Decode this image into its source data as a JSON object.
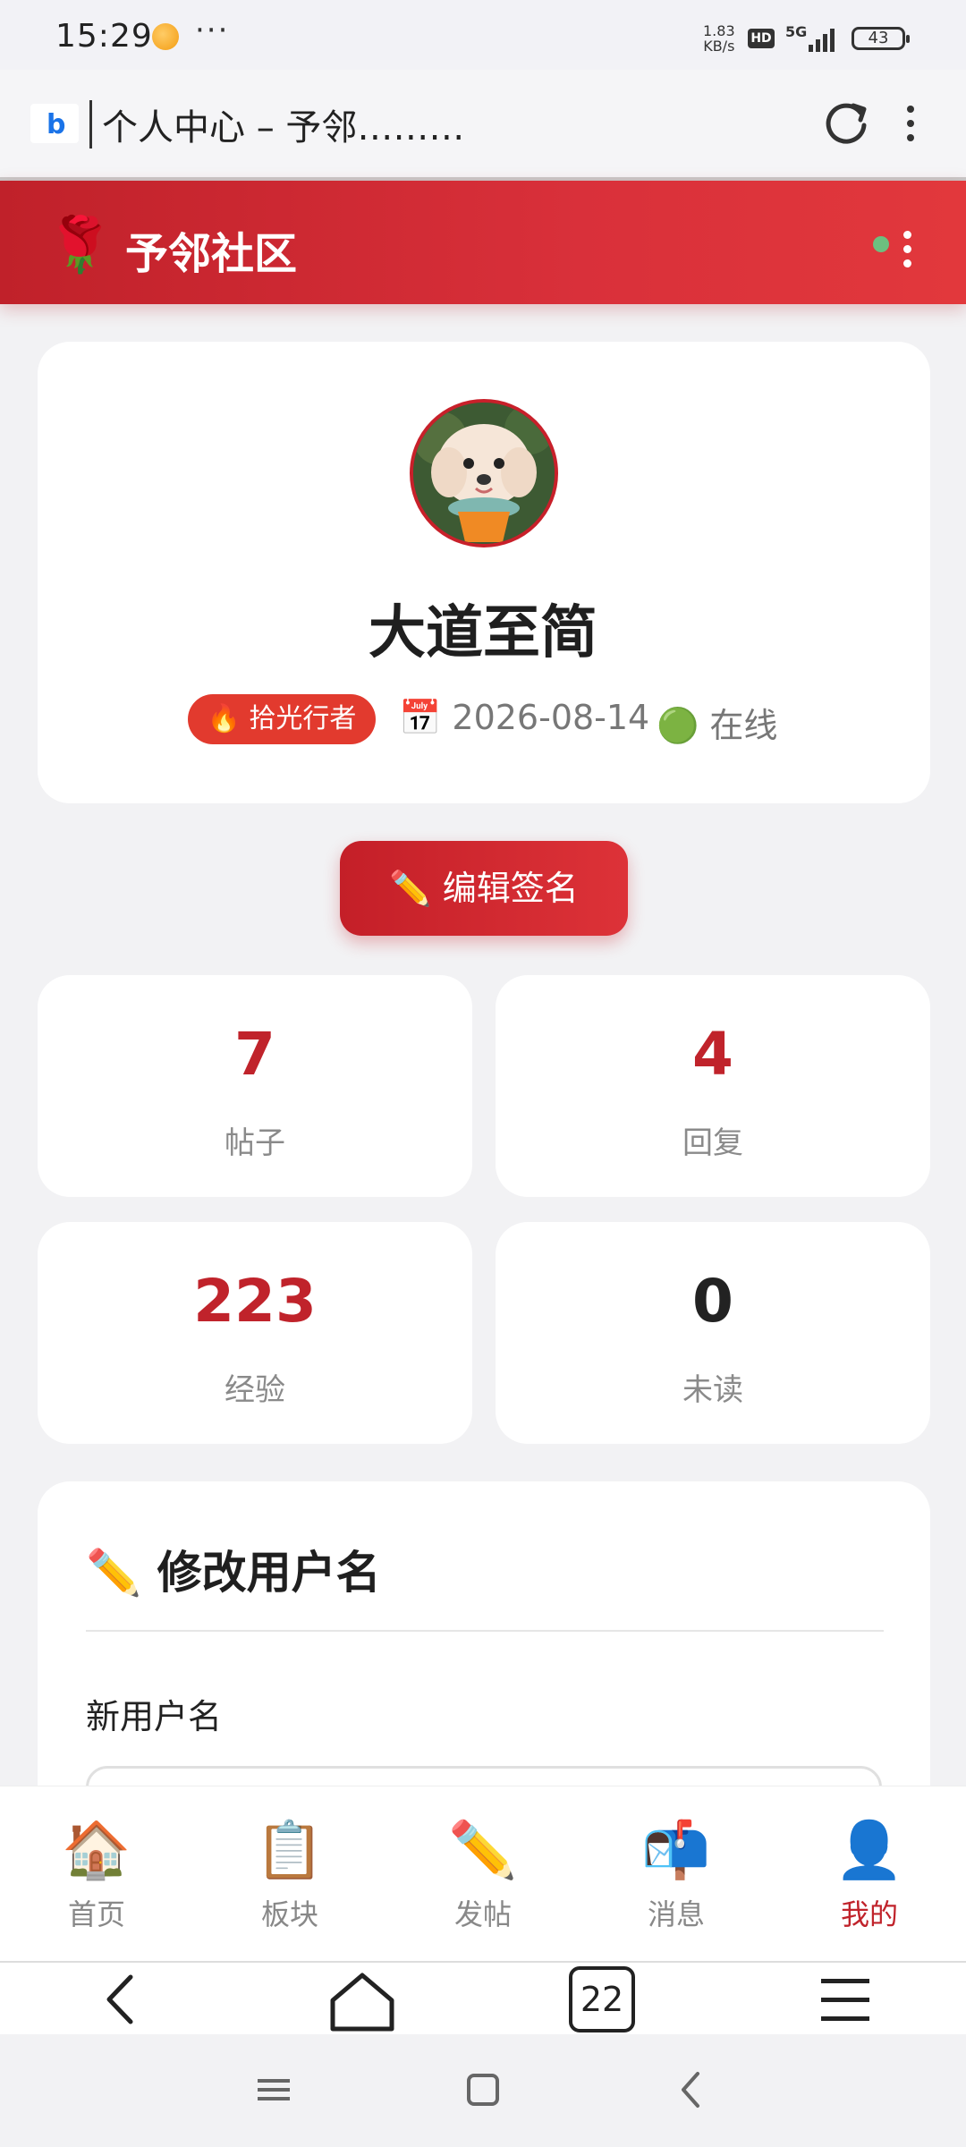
{
  "status_bar": {
    "time": "15:29",
    "more": "···",
    "net_speed_value": "1.83",
    "net_speed_unit": "KB/s",
    "hd_label": "HD",
    "network": "5G",
    "battery": "43"
  },
  "browser": {
    "tab_title": "个人中心 – 予邻………",
    "favicon_glyph": "b"
  },
  "site": {
    "logo_emoji": "🌹",
    "name": "予邻社区"
  },
  "profile": {
    "username": "大道至简",
    "badge": "🔥 拾光行者",
    "join_date": "📅 2026-08-14",
    "status": "🟢 在线",
    "edit_signature_label": "✏️ 编辑签名"
  },
  "stats": [
    {
      "value": "7",
      "label": "帖子",
      "color": "#c0232b"
    },
    {
      "value": "4",
      "label": "回复",
      "color": "#c0232b"
    },
    {
      "value": "223",
      "label": "经验",
      "color": "#c0232b"
    },
    {
      "value": "0",
      "label": "未读",
      "color": "#222222"
    }
  ],
  "rename_section": {
    "title": "✏️ 修改用户名",
    "field_label": "新用户名"
  },
  "bottom_nav": [
    {
      "icon": "🏠",
      "icon_name": "home-icon",
      "label": "首页"
    },
    {
      "icon": "📋",
      "icon_name": "board-icon",
      "label": "板块"
    },
    {
      "icon": "✏️",
      "icon_name": "pencil-icon",
      "label": "发帖"
    },
    {
      "icon": "📬",
      "icon_name": "mailbox-icon",
      "label": "消息"
    },
    {
      "icon": "👤",
      "icon_name": "user-icon",
      "label": "我的",
      "active": true
    }
  ],
  "browser_nav": {
    "tab_count": "22"
  },
  "colors": {
    "brand_red": "#c0232b",
    "online_green": "#6dbf7f"
  }
}
